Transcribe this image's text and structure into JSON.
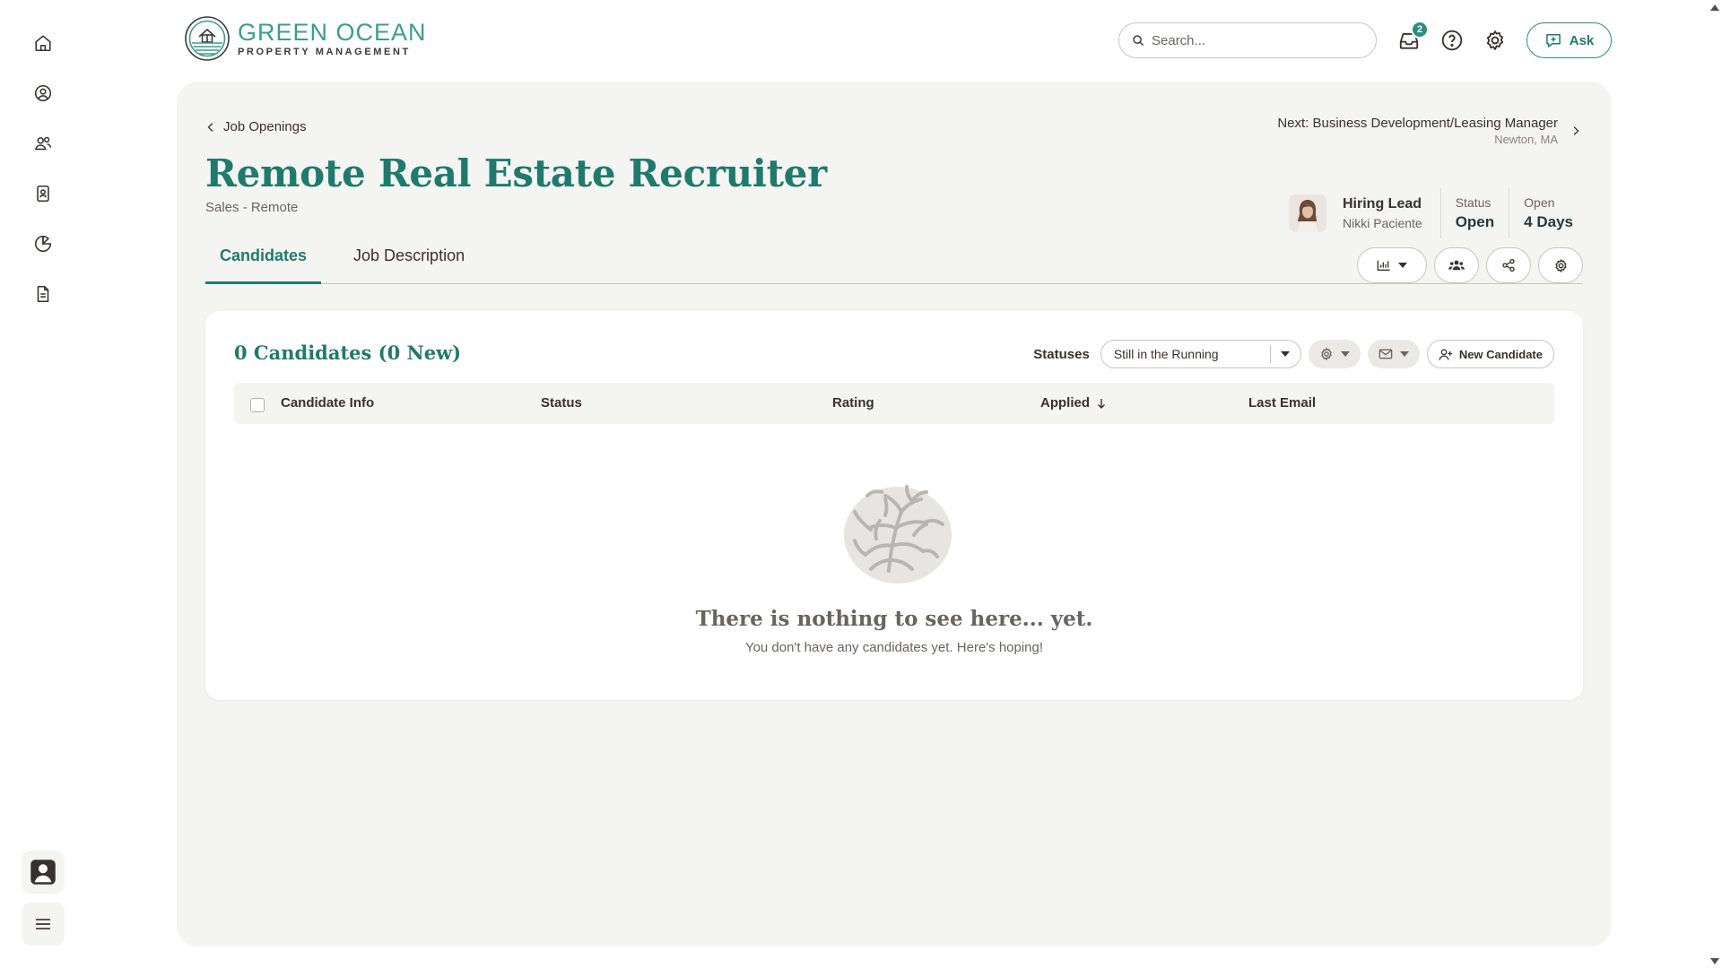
{
  "brand": {
    "name": "GREEN OCEAN",
    "subtitle": "PROPERTY MANAGEMENT",
    "accent": "#2a8d7f"
  },
  "header": {
    "search_placeholder": "Search...",
    "notifications_count": "2",
    "ask_label": "Ask"
  },
  "nav": {
    "items": [
      "home-icon",
      "person-circle-icon",
      "people-icon",
      "badge-icon",
      "pie-chart-icon",
      "document-icon"
    ],
    "bottom": [
      "user-avatar-icon",
      "menu-icon"
    ]
  },
  "page": {
    "back_label": "Job Openings",
    "next_title": "Next: Business Development/Leasing Manager",
    "next_location": "Newton, MA",
    "title": "Remote Real Estate Recruiter",
    "subtitle": "Sales - Remote",
    "hiring_lead_label": "Hiring Lead",
    "hiring_lead_name": "Nikki Paciente",
    "status_label": "Status",
    "status_value": "Open",
    "open_label": "Open",
    "open_value": "4 Days"
  },
  "tabs": [
    {
      "label": "Candidates",
      "active": true
    },
    {
      "label": "Job Description",
      "active": false
    }
  ],
  "candidates": {
    "count_label": "0 Candidates (0 New)",
    "statuses_label": "Statuses",
    "status_filter": "Still in the Running",
    "new_candidate_label": "New Candidate",
    "columns": [
      "Candidate Info",
      "Status",
      "Rating",
      "Applied",
      "Last Email"
    ],
    "empty_title": "There is nothing to see here... yet.",
    "empty_subtitle": "You don't have any candidates yet. Here's hoping!"
  }
}
